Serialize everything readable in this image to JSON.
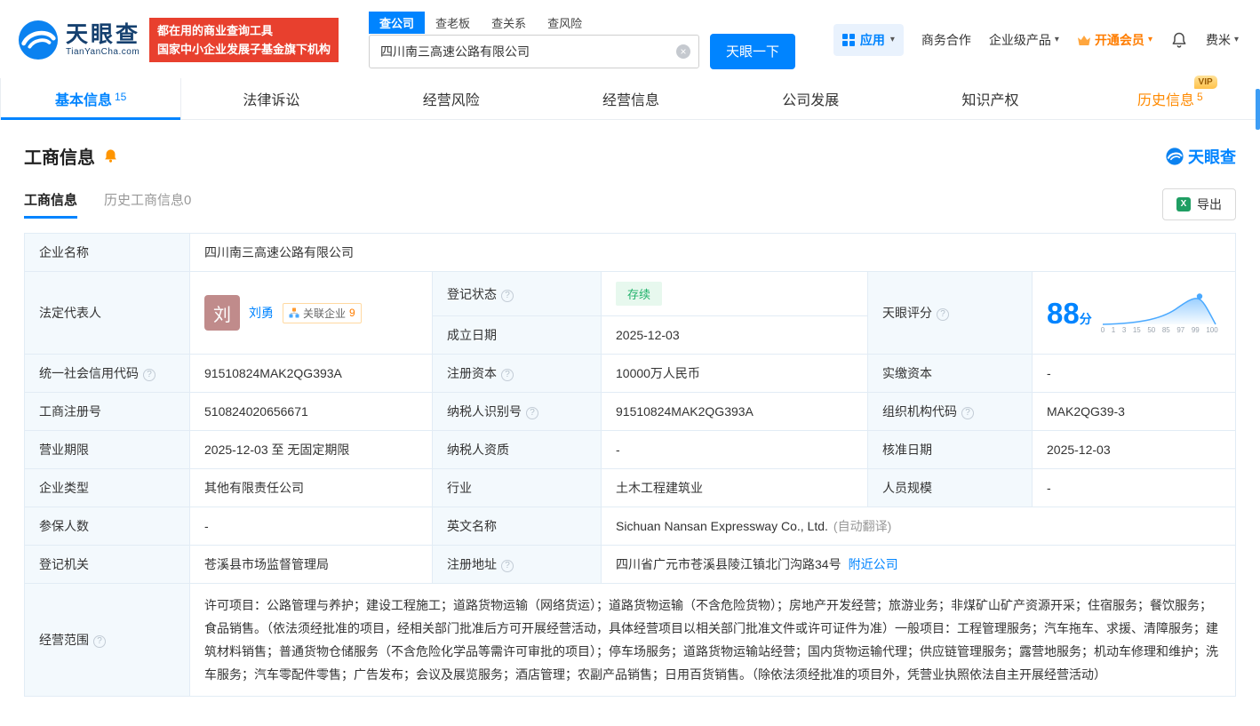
{
  "header": {
    "logo": {
      "name": "天眼查",
      "domain": "TianYanCha.com"
    },
    "promo": {
      "line1": "都在用的商业查询工具",
      "line2": "国家中小企业发展子基金旗下机构"
    },
    "search": {
      "tabs": {
        "company": "查公司",
        "boss": "查老板",
        "relation": "查关系",
        "risk": "查风险"
      },
      "value": "四川南三高速公路有限公司",
      "button": "天眼一下"
    },
    "menu": {
      "apps": "应用",
      "cooperation": "商务合作",
      "enterprise_products": "企业级产品",
      "vip": "开通会员",
      "username": "费米"
    }
  },
  "nav": {
    "basic": "基本信息",
    "basic_count": "15",
    "legal": "法律诉讼",
    "risk": "经营风险",
    "operation": "经营信息",
    "development": "公司发展",
    "ip": "知识产权",
    "history": "历史信息",
    "history_count": "5",
    "history_vip": "VIP"
  },
  "section": {
    "title": "工商信息",
    "watermark": "天眼查",
    "tab_current": "工商信息",
    "tab_history": "历史工商信息",
    "tab_history_count": "0",
    "export": "导出"
  },
  "table": {
    "company_name": {
      "label": "企业名称",
      "value": "四川南三高速公路有限公司"
    },
    "legal_rep": {
      "label": "法定代表人",
      "avatar": "刘",
      "name": "刘勇",
      "related_label": "关联企业",
      "related_count": "9"
    },
    "reg_status": {
      "label": "登记状态",
      "value": "存续"
    },
    "est_date": {
      "label": "成立日期",
      "value": "2025-12-03"
    },
    "score": {
      "label": "天眼评分",
      "value": "88",
      "unit": "分",
      "ticks": [
        "0",
        "1",
        "3",
        "15",
        "50",
        "85",
        "97",
        "99",
        "100"
      ]
    },
    "credit_code": {
      "label": "统一社会信用代码",
      "value": "91510824MAK2QG393A"
    },
    "reg_capital": {
      "label": "注册资本",
      "value": "10000万人民币"
    },
    "paid_capital": {
      "label": "实缴资本",
      "value": "-"
    },
    "reg_number": {
      "label": "工商注册号",
      "value": "510824020656671"
    },
    "taxpayer_id": {
      "label": "纳税人识别号",
      "value": "91510824MAK2QG393A"
    },
    "org_code": {
      "label": "组织机构代码",
      "value": "MAK2QG39-3"
    },
    "business_term": {
      "label": "营业期限",
      "value": "2025-12-03 至 无固定期限"
    },
    "taxpayer_quality": {
      "label": "纳税人资质",
      "value": "-"
    },
    "approval_date": {
      "label": "核准日期",
      "value": "2025-12-03"
    },
    "company_type": {
      "label": "企业类型",
      "value": "其他有限责任公司"
    },
    "industry": {
      "label": "行业",
      "value": "土木工程建筑业"
    },
    "staff_size": {
      "label": "人员规模",
      "value": "-"
    },
    "insured_count": {
      "label": "参保人数",
      "value": "-"
    },
    "english_name": {
      "label": "英文名称",
      "value": "Sichuan Nansan Expressway Co., Ltd.",
      "note": "(自动翻译)"
    },
    "reg_authority": {
      "label": "登记机关",
      "value": "苍溪县市场监督管理局"
    },
    "reg_address": {
      "label": "注册地址",
      "value": "四川省广元市苍溪县陵江镇北门沟路34号",
      "link": "附近公司"
    },
    "business_scope": {
      "label": "经营范围",
      "value": "许可项目：公路管理与养护；建设工程施工；道路货物运输（网络货运）；道路货物运输（不含危险货物）；房地产开发经营；旅游业务；非煤矿山矿产资源开采；住宿服务；餐饮服务；食品销售。（依法须经批准的项目，经相关部门批准后方可开展经营活动，具体经营项目以相关部门批准文件或许可证件为准）一般项目：工程管理服务；汽车拖车、求援、清障服务；建筑材料销售；普通货物仓储服务（不含危险化学品等需许可审批的项目）；停车场服务；道路货物运输站经营；国内货物运输代理；供应链管理服务；露营地服务；机动车修理和维护；洗车服务；汽车零配件零售；广告发布；会议及展览服务；酒店管理；农副产品销售；日用百货销售。（除依法须经批准的项目外，凭营业执照依法自主开展经营活动）"
    }
  },
  "icons": {
    "clear": "×",
    "caret_down": "▾",
    "help": "?",
    "excel": "X"
  },
  "colors": {
    "brand_blue": "#0084ff",
    "vip_orange": "#ff7d00",
    "status_green": "#21b26b",
    "promo_red": "#e8402e",
    "history_orange": "#ff8a00"
  }
}
